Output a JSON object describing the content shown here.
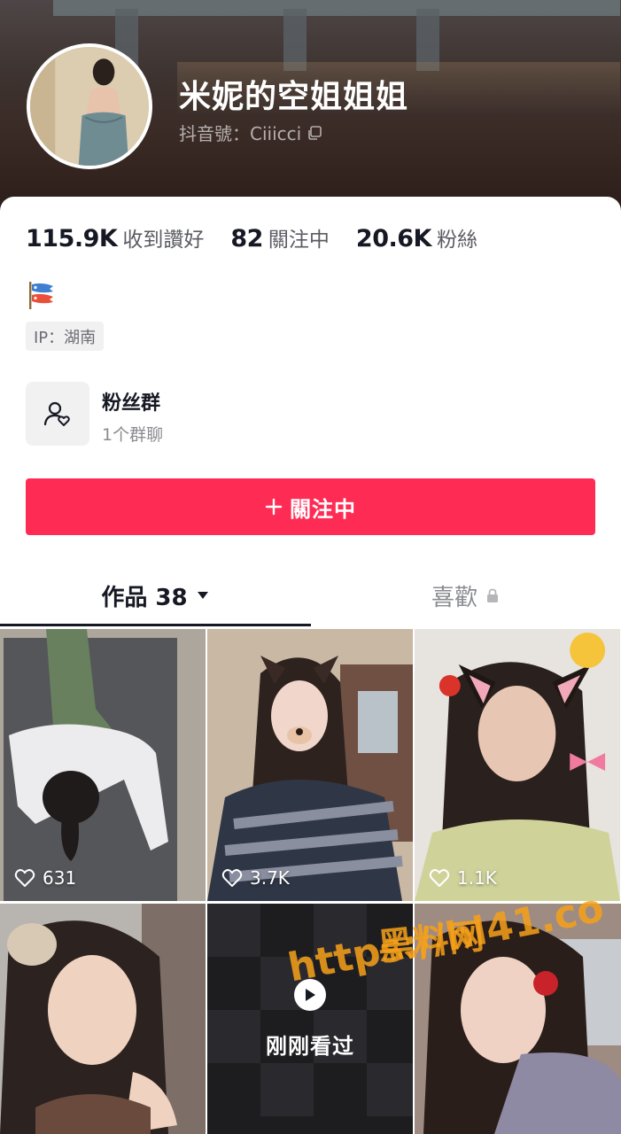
{
  "profile": {
    "nickname": "米妮的空姐姐姐",
    "handle": "抖音號：Ciiicci",
    "avatar_icon": "avatar-photo",
    "copy_icon": "copy-icon"
  },
  "stats": [
    {
      "value": "115.9K",
      "label": "收到讚好"
    },
    {
      "value": "82",
      "label": "關注中"
    },
    {
      "value": "20.6K",
      "label": "粉絲"
    }
  ],
  "bio": {
    "emoji_icon": "carp-streamer-icon"
  },
  "ip_location": "IP：湖南",
  "fan_group": {
    "title": "粉丝群",
    "subtitle": "1个群聊",
    "icon": "group-user-heart-icon"
  },
  "follow_button": {
    "label": "關注中",
    "icon": "plus-icon"
  },
  "tabs": {
    "works": {
      "label": "作品 38",
      "icon": "caret-down-icon"
    },
    "likes": {
      "label": "喜歡",
      "icon": "lock-icon"
    }
  },
  "videos": [
    {
      "likes": "631"
    },
    {
      "likes": "3.7K"
    },
    {
      "likes": "1.1K"
    },
    {
      "likes": ""
    },
    {
      "overlay": "刚刚看过",
      "icon": "play-icon"
    },
    {
      "likes": ""
    }
  ],
  "watermark": {
    "line1": "黑料网",
    "line2": "https://hl41.co"
  },
  "colors": {
    "accent": "#fe2c55",
    "text_primary": "#161823",
    "text_secondary": "#8a8b91",
    "watermark": "#f7a11a"
  }
}
